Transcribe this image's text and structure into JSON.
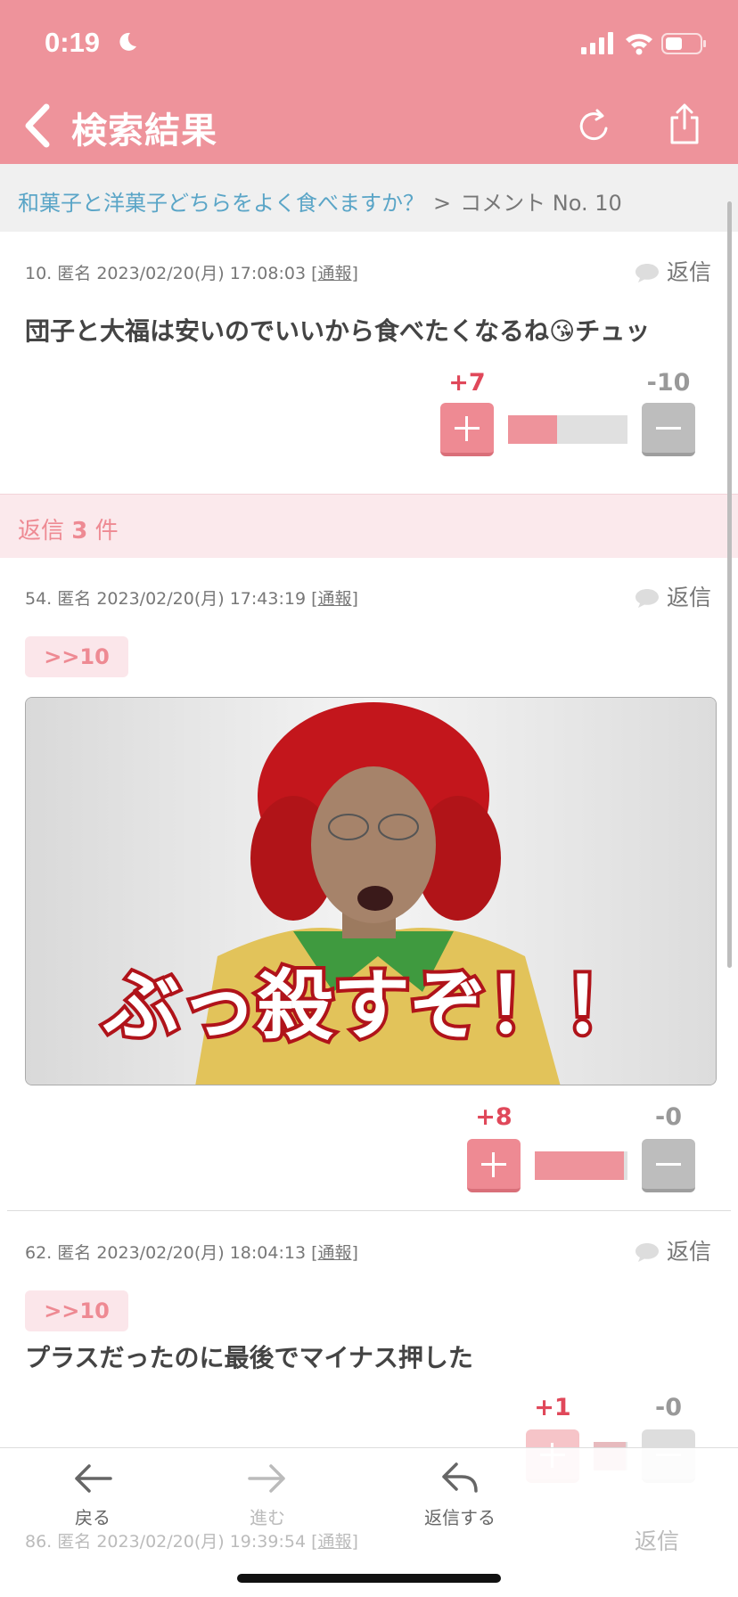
{
  "status_bar": {
    "time": "0:19"
  },
  "header": {
    "title": "検索結果"
  },
  "breadcrumb": {
    "topic": "和菓子と洋菓子どちらをよく食べますか？",
    "separator": ">",
    "current": "コメント No. 10"
  },
  "comment_main": {
    "number": "10.",
    "author": "匿名",
    "datetime": "2023/02/20(月) 17:08:03",
    "report_label": "通報",
    "reply_label": "返信",
    "text": "団子と大福は安いのでいいから食べたくなるね😘チュッ",
    "plus": "+7",
    "minus": "-10",
    "plus_ratio": 0.41
  },
  "replies_header": {
    "prefix": "返信",
    "count": "3",
    "suffix": "件"
  },
  "replies": [
    {
      "number": "54.",
      "author": "匿名",
      "datetime": "2023/02/20(月) 17:43:19",
      "report_label": "通報",
      "reply_label": "返信",
      "anchor": ">>10",
      "image_caption": "ぶっ殺すぞ！！",
      "plus": "+8",
      "minus": "-0",
      "plus_ratio": 1.0
    },
    {
      "number": "62.",
      "author": "匿名",
      "datetime": "2023/02/20(月) 18:04:13",
      "report_label": "通報",
      "reply_label": "返信",
      "anchor": ">>10",
      "text": "プラスだったのに最後でマイナス押した",
      "plus": "+1",
      "minus": "-0",
      "plus_ratio": 1.0
    },
    {
      "number": "86.",
      "author": "匿名",
      "datetime": "2023/02/20(月) 19:39:54",
      "report_label": "通報",
      "reply_label": "返信"
    }
  ],
  "toolbar": {
    "back": "戻る",
    "forward": "進む",
    "reply": "返信する"
  },
  "colors": {
    "header": "#ee939b",
    "plus": "#e0485a",
    "link": "#5aa5c7",
    "reply_bg": "#fbe9ec"
  },
  "icons": [
    "moon-icon",
    "signal-icon",
    "wifi-icon",
    "battery-icon",
    "back-chevron-icon",
    "refresh-icon",
    "share-icon",
    "speech-bubble-icon",
    "arrow-left-icon",
    "arrow-right-icon",
    "reply-arrow-icon"
  ]
}
